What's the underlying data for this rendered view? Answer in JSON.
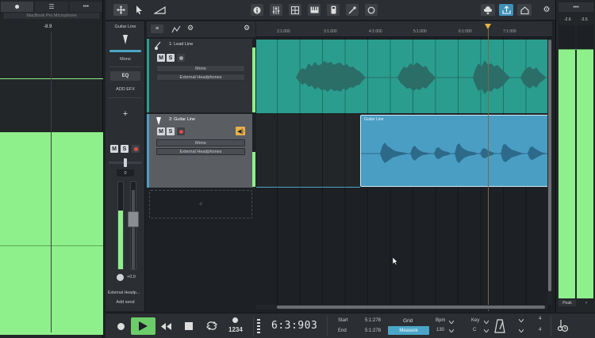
{
  "left_panel": {
    "device": "MacBook Pro Microphone",
    "level_value": "-8.9"
  },
  "toolbar": {
    "left_icons": [
      "move-icon",
      "pointer-icon",
      "fade-icon"
    ],
    "center_icons": [
      "info-icon",
      "mixer-icon",
      "grid-icon",
      "keyboard-icon",
      "remote-icon",
      "tuner-icon",
      "loop-icon"
    ],
    "right_icons": [
      "cloud-icon",
      "upload-icon",
      "home-icon",
      "settings-icon"
    ]
  },
  "channel_strip": {
    "name": "Guitar Line",
    "mode": "Mono",
    "eq_label": "EQ",
    "add_efx_label": "ADD EFX",
    "add_symbol": "+",
    "m": "M",
    "s": "S",
    "pan_value": "0",
    "gain_value": "+0.0",
    "output": "External Headp...",
    "add_send": "Add send"
  },
  "tracks": [
    {
      "name": "1: Lead Line",
      "m": "M",
      "s": "S",
      "mode": "Mono",
      "output": "External Headphones"
    },
    {
      "name": "2: Guitar Line",
      "m": "M",
      "s": "S",
      "mode": "Mono",
      "output": "External Headphones"
    }
  ],
  "add_track_symbol": "+",
  "ruler": {
    "marks": [
      "2:1:000",
      "3:1:000",
      "4:1:000",
      "5:1:000",
      "6:1:000",
      "7:1:000"
    ]
  },
  "clips": {
    "guitar_clip_label": "Guitar Line"
  },
  "right_panel": {
    "left_value": "-2.6",
    "right_value": "-3.5",
    "mode_label": "Peak"
  },
  "transport": {
    "time": "6:3:903",
    "count_in": "1234",
    "start_label": "Start",
    "start_value": "5:1:278",
    "end_label": "End",
    "end_value": "5:1:278",
    "grid_label": "Grid",
    "grid_value": "Measure",
    "bpm_label": "Bpm",
    "bpm_value": "130",
    "key_label": "Key",
    "key_value": "C",
    "sig_top": "4",
    "sig_bottom": "4"
  },
  "colors": {
    "meter_green": "#8ef08a",
    "track1_teal": "#2a9d8f",
    "clip_blue": "#4a9ec4",
    "accent_yellow": "#e8b04a",
    "grid_blue": "#4aa6c8"
  }
}
